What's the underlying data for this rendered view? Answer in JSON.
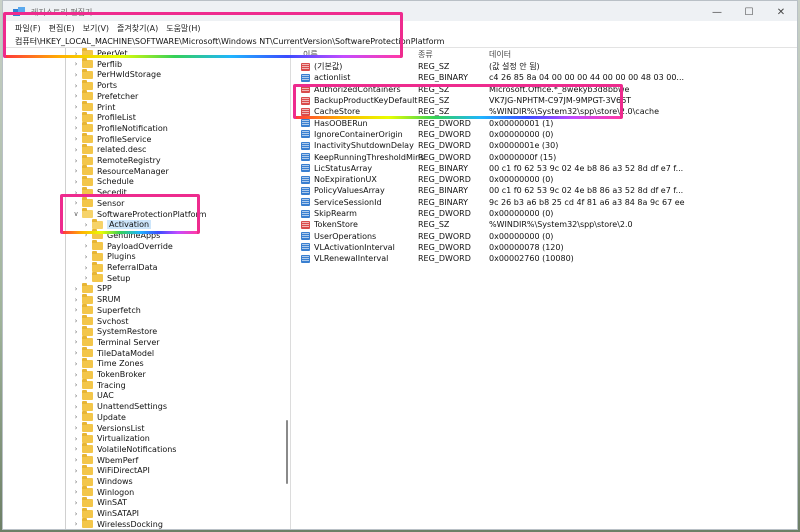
{
  "window": {
    "title": "레지스트리 편집기",
    "controls": [
      "—",
      "☐",
      "✕"
    ]
  },
  "menu": [
    "파일(F)",
    "편집(E)",
    "보기(V)",
    "즐겨찾기(A)",
    "도움말(H)"
  ],
  "address": "컴퓨터\\HKEY_LOCAL_MACHINE\\SOFTWARE\\Microsoft\\Windows NT\\CurrentVersion\\SoftwareProtectionPlatform",
  "tree": [
    {
      "label": "PeerVet",
      "depth": 1,
      "expanded": false
    },
    {
      "label": "Perflib",
      "depth": 1,
      "expanded": false
    },
    {
      "label": "PerHwIdStorage",
      "depth": 1,
      "expanded": false
    },
    {
      "label": "Ports",
      "depth": 1,
      "expanded": false
    },
    {
      "label": "Prefetcher",
      "depth": 1,
      "expanded": false
    },
    {
      "label": "Print",
      "depth": 1,
      "expanded": false
    },
    {
      "label": "ProfileList",
      "depth": 1,
      "expanded": false
    },
    {
      "label": "ProfileNotification",
      "depth": 1,
      "expanded": false
    },
    {
      "label": "ProfileService",
      "depth": 1,
      "expanded": false
    },
    {
      "label": "related.desc",
      "depth": 1,
      "expanded": false
    },
    {
      "label": "RemoteRegistry",
      "depth": 1,
      "expanded": false
    },
    {
      "label": "ResourceManager",
      "depth": 1,
      "expanded": false
    },
    {
      "label": "Schedule",
      "depth": 1,
      "expanded": false
    },
    {
      "label": "Secedit",
      "depth": 1,
      "expanded": false
    },
    {
      "label": "Sensor",
      "depth": 1,
      "expanded": false
    },
    {
      "label": "SoftwareProtectionPlatform",
      "depth": 1,
      "expanded": true
    },
    {
      "label": "Activation",
      "depth": 2,
      "expanded": false,
      "selected": true
    },
    {
      "label": "GenuineApps",
      "depth": 2,
      "expanded": false
    },
    {
      "label": "PayloadOverride",
      "depth": 2,
      "expanded": false
    },
    {
      "label": "Plugins",
      "depth": 2,
      "expanded": false
    },
    {
      "label": "ReferralData",
      "depth": 2,
      "expanded": false
    },
    {
      "label": "Setup",
      "depth": 2,
      "expanded": false
    },
    {
      "label": "SPP",
      "depth": 1,
      "expanded": false
    },
    {
      "label": "SRUM",
      "depth": 1,
      "expanded": false
    },
    {
      "label": "Superfetch",
      "depth": 1,
      "expanded": false
    },
    {
      "label": "Svchost",
      "depth": 1,
      "expanded": false
    },
    {
      "label": "SystemRestore",
      "depth": 1,
      "expanded": false
    },
    {
      "label": "Terminal Server",
      "depth": 1,
      "expanded": false
    },
    {
      "label": "TileDataModel",
      "depth": 1,
      "expanded": false
    },
    {
      "label": "Time Zones",
      "depth": 1,
      "expanded": false
    },
    {
      "label": "TokenBroker",
      "depth": 1,
      "expanded": false
    },
    {
      "label": "Tracing",
      "depth": 1,
      "expanded": false
    },
    {
      "label": "UAC",
      "depth": 1,
      "expanded": false
    },
    {
      "label": "UnattendSettings",
      "depth": 1,
      "expanded": false
    },
    {
      "label": "Update",
      "depth": 1,
      "expanded": false
    },
    {
      "label": "VersionsList",
      "depth": 1,
      "expanded": false
    },
    {
      "label": "Virtualization",
      "depth": 1,
      "expanded": false
    },
    {
      "label": "VolatileNotifications",
      "depth": 1,
      "expanded": false
    },
    {
      "label": "WbemPerf",
      "depth": 1,
      "expanded": false
    },
    {
      "label": "WiFiDirectAPI",
      "depth": 1,
      "expanded": false
    },
    {
      "label": "Windows",
      "depth": 1,
      "expanded": false
    },
    {
      "label": "Winlogon",
      "depth": 1,
      "expanded": false
    },
    {
      "label": "WinSAT",
      "depth": 1,
      "expanded": false
    },
    {
      "label": "WinSATAPI",
      "depth": 1,
      "expanded": false
    },
    {
      "label": "WirelessDocking",
      "depth": 1,
      "expanded": false
    }
  ],
  "list": {
    "headers": {
      "name": "이름",
      "type": "종류",
      "data": "데이터"
    },
    "rows": [
      {
        "icon": "ab",
        "name": "(기본값)",
        "type": "REG_SZ",
        "data": "(값 설정 안 됨)"
      },
      {
        "icon": "bin",
        "name": "actionlist",
        "type": "REG_BINARY",
        "data": "c4 26 85 8a 04 00 00 00 44 00 00 00 48 03 00..."
      },
      {
        "icon": "ab",
        "name": "AuthorizedContainers",
        "type": "REG_SZ",
        "data": "Microsoft.Office.*_8wekyb3d8bbwe"
      },
      {
        "icon": "ab",
        "name": "BackupProductKeyDefault",
        "type": "REG_SZ",
        "data": "VK7JG-NPHTM-C97JM-9MPGT-3V66T"
      },
      {
        "icon": "ab",
        "name": "CacheStore",
        "type": "REG_SZ",
        "data": "%WINDIR%\\System32\\spp\\store\\2.0\\cache"
      },
      {
        "icon": "bin",
        "name": "HasOOBERun",
        "type": "REG_DWORD",
        "data": "0x00000001 (1)"
      },
      {
        "icon": "bin",
        "name": "IgnoreContainerOrigin",
        "type": "REG_DWORD",
        "data": "0x00000000 (0)"
      },
      {
        "icon": "bin",
        "name": "InactivityShutdownDelay",
        "type": "REG_DWORD",
        "data": "0x0000001e (30)"
      },
      {
        "icon": "bin",
        "name": "KeepRunningThresholdMins",
        "type": "REG_DWORD",
        "data": "0x0000000f (15)"
      },
      {
        "icon": "bin",
        "name": "LicStatusArray",
        "type": "REG_BINARY",
        "data": "00 c1 f0 62 53 9c 02 4e b8 86 a3 52 8d df e7 f..."
      },
      {
        "icon": "bin",
        "name": "NoExpirationUX",
        "type": "REG_DWORD",
        "data": "0x00000000 (0)"
      },
      {
        "icon": "bin",
        "name": "PolicyValuesArray",
        "type": "REG_BINARY",
        "data": "00 c1 f0 62 53 9c 02 4e b8 86 a3 52 8d df e7 f..."
      },
      {
        "icon": "bin",
        "name": "ServiceSessionId",
        "type": "REG_BINARY",
        "data": "9c 26 b3 a6 b8 25 cd 4f 81 a6 a3 84 8a 9c 67 ee"
      },
      {
        "icon": "bin",
        "name": "SkipRearm",
        "type": "REG_DWORD",
        "data": "0x00000000 (0)"
      },
      {
        "icon": "ab",
        "name": "TokenStore",
        "type": "REG_SZ",
        "data": "%WINDIR%\\System32\\spp\\store\\2.0"
      },
      {
        "icon": "bin",
        "name": "UserOperations",
        "type": "REG_DWORD",
        "data": "0x00000000 (0)"
      },
      {
        "icon": "bin",
        "name": "VLActivationInterval",
        "type": "REG_DWORD",
        "data": "0x00000078 (120)"
      },
      {
        "icon": "bin",
        "name": "VLRenewalInterval",
        "type": "REG_DWORD",
        "data": "0x00002760 (10080)"
      }
    ]
  },
  "colors": {
    "highlight": "#ee2b8e",
    "selection": "#cde6fb",
    "folder": "#f3c64a"
  }
}
